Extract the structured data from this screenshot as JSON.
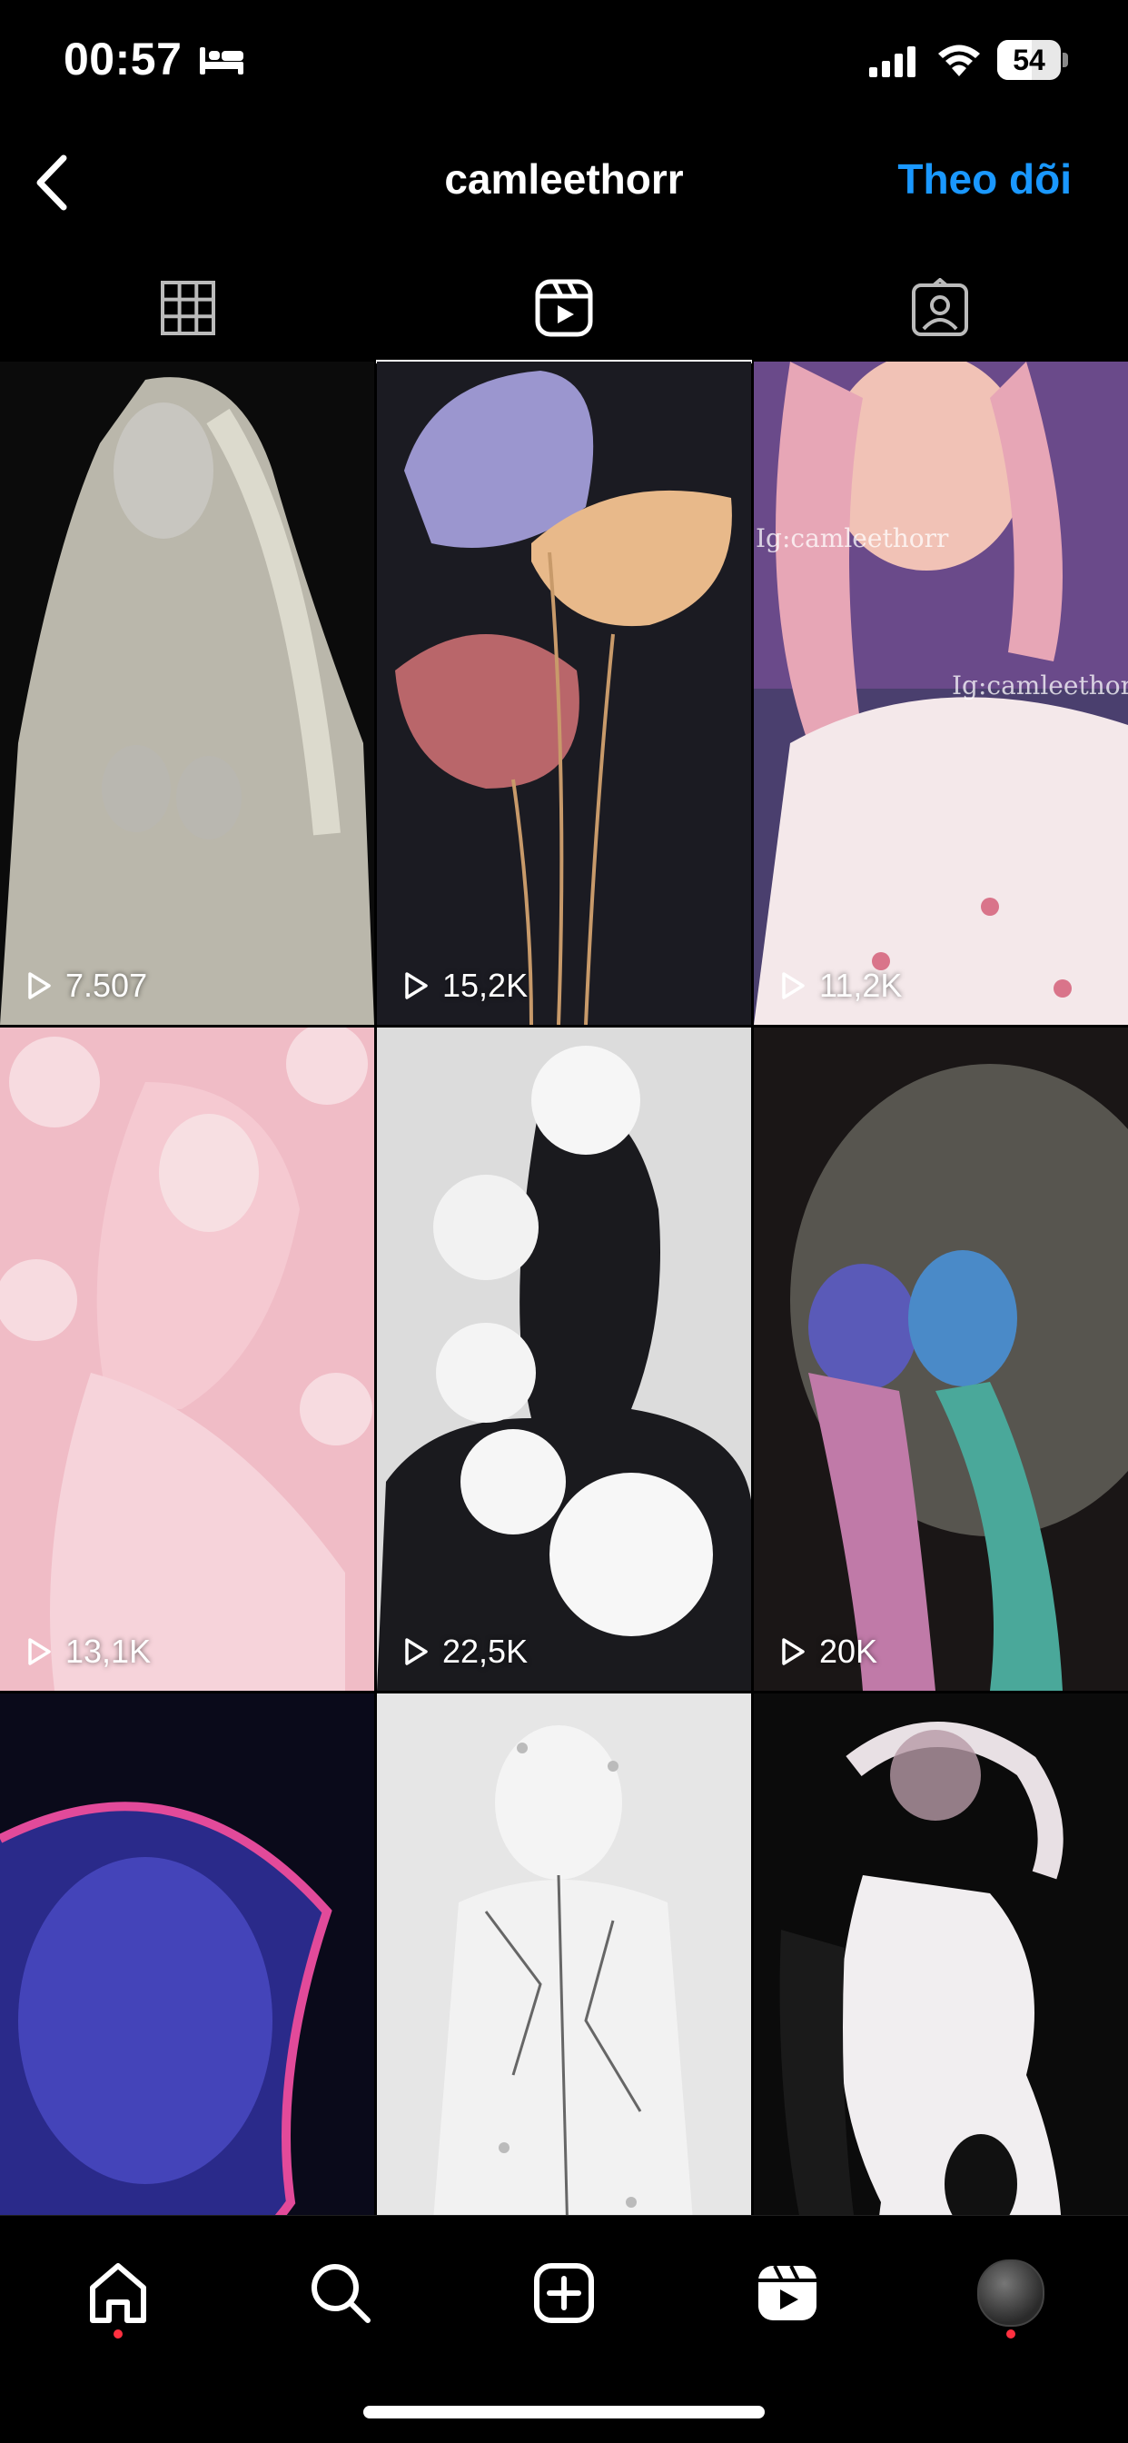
{
  "status_bar": {
    "time": "00:57",
    "battery": "54",
    "battery_level": 0.54
  },
  "header": {
    "username": "camleethorr",
    "follow_label": "Theo dõi"
  },
  "tabs": [
    {
      "icon": "grid-icon",
      "selected": false
    },
    {
      "icon": "reels-icon",
      "selected": true
    },
    {
      "icon": "tagged-icon",
      "selected": false
    }
  ],
  "reels": [
    {
      "views": "7.507",
      "icon": "play-icon"
    },
    {
      "views": "15,2K",
      "icon": "play-icon"
    },
    {
      "views": "11,2K",
      "icon": "play-icon",
      "watermark": "Ig:camleethorr",
      "watermark2": "Ig:camleethorr"
    },
    {
      "views": "13,1K",
      "icon": "play-icon"
    },
    {
      "views": "22,5K",
      "icon": "play-icon"
    },
    {
      "views": "20K",
      "icon": "play-icon"
    },
    {
      "views": "",
      "icon": "play-icon"
    },
    {
      "views": "",
      "icon": "play-icon"
    },
    {
      "views": "",
      "icon": "play-icon"
    }
  ],
  "bottom_nav": [
    {
      "icon": "home-icon",
      "notification_dot": true
    },
    {
      "icon": "search-icon"
    },
    {
      "icon": "create-icon"
    },
    {
      "icon": "reels-icon"
    },
    {
      "icon": "profile-avatar",
      "notification_dot": true
    }
  ],
  "colors": {
    "accent": "#1a98ff",
    "background": "#000000",
    "notification": "#ff3040"
  }
}
